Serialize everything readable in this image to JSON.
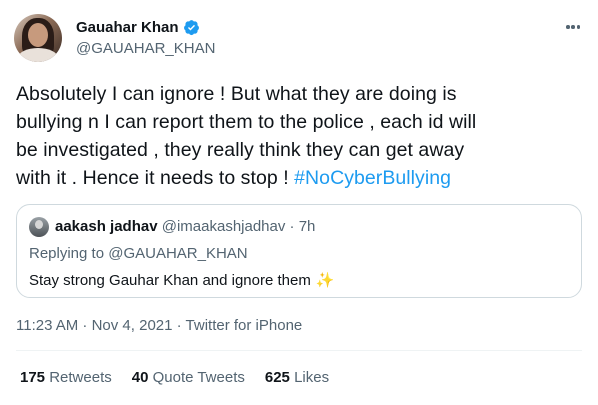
{
  "author": {
    "display_name": "Gauahar Khan",
    "handle": "@GAUAHAR_KHAN",
    "verified": true
  },
  "tweet": {
    "lines": [
      "Absolutely I can ignore ! But what they are doing is",
      "bullying n I can report them to the police , each id will",
      "be investigated , they really think they can get away",
      "with it . Hence it needs to stop ! "
    ],
    "hashtag": "#NoCyberBullying"
  },
  "quoted_tweet": {
    "display_name": "aakash jadhav",
    "meta": "@imaakashjadhav · 7h",
    "replying_prefix": "Replying to ",
    "replying_to": "@GAUAHAR_KHAN",
    "text": "Stay strong Gauhar Khan and ignore them",
    "emoji": "✨"
  },
  "timestamp": {
    "time_date": "11:23 AM · Nov 4, 2021 · ",
    "source": "Twitter for iPhone"
  },
  "stats": {
    "retweets_count": "175",
    "retweets_label": "Retweets",
    "quotes_count": "40",
    "quotes_label": "Quote Tweets",
    "likes_count": "625",
    "likes_label": "Likes"
  },
  "colors": {
    "accent": "#1d9bf0",
    "secondary_text": "#536471",
    "primary_text": "#0f1419",
    "border": "#cfd9de"
  }
}
